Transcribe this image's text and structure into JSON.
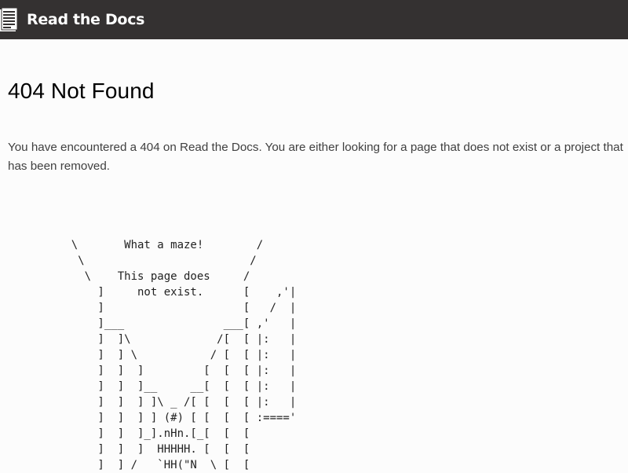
{
  "header": {
    "logo_icon": "document-book-icon",
    "brand": "Read the Docs"
  },
  "main": {
    "title": "404 Not Found",
    "message": "You have encountered a 404 on Read the Docs. You are either looking for a page that does not exist or a project that has been removed.",
    "ascii_art": "    \\       What a maze!        /\n     \\                         /\n      \\    This page does     /\n        ]     not exist.      [    ,'|\n        ]                     [   /  |\n        ]___               ___[ ,'   |\n        ]  ]\\             /[  [ |:   |\n        ]  ] \\           / [  [ |:   |\n        ]  ]  ]         [  [  [ |:   |\n        ]  ]  ]__     __[  [  [ |:   |\n        ]  ]  ] ]\\ _ /[ [  [  [ |:   |\n        ]  ]  ] ] (#) [ [  [  [ :===='\n        ]  ]  ]_].nHn.[_[  [  [\n        ]  ]  ]  HHHHH. [  [  [\n        ]  ] /   `HH(\"N  \\ [  ["
  }
}
